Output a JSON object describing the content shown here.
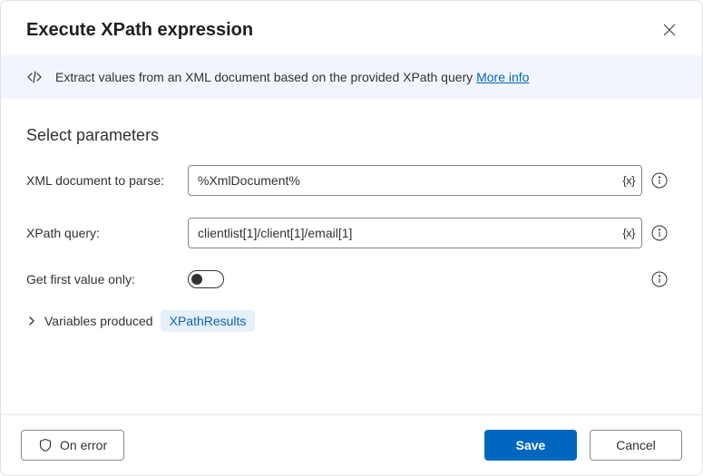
{
  "dialog": {
    "title": "Execute XPath expression"
  },
  "banner": {
    "description": "Extract values from an XML document based on the provided XPath query ",
    "link_text": "More info"
  },
  "section": {
    "title": "Select parameters"
  },
  "params": {
    "xml_doc_label": "XML document to parse:",
    "xml_doc_value": "%XmlDocument%",
    "xpath_label": "XPath query:",
    "xpath_value": "clientlist[1]/client[1]/email[1]",
    "first_value_label": "Get first value only:",
    "first_value_on": false
  },
  "variables": {
    "label": "Variables produced",
    "badge": "XPathResults"
  },
  "footer": {
    "on_error": "On error",
    "save": "Save",
    "cancel": "Cancel"
  },
  "var_token": "{x}"
}
